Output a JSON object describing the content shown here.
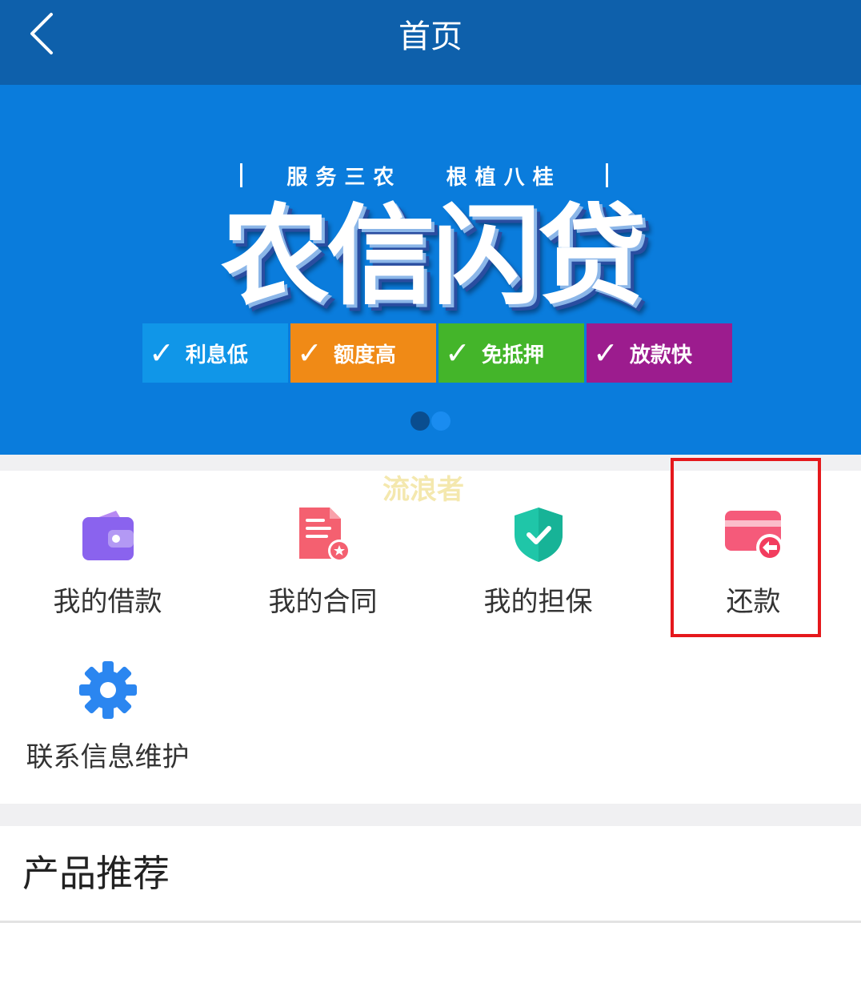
{
  "header": {
    "title": "首页",
    "back_icon": "chevron-left-icon"
  },
  "banner": {
    "slogan_left": "服务三农",
    "slogan_right": "根植八桂",
    "title": "农信闪贷",
    "tags": [
      {
        "label": "利息低",
        "color": "#1096e8"
      },
      {
        "label": "额度高",
        "color": "#f08a16"
      },
      {
        "label": "免抵押",
        "color": "#44b52a"
      },
      {
        "label": "放款快",
        "color": "#9c1c8e"
      }
    ],
    "carousel": {
      "count": 2,
      "active": 2,
      "dot_colors": [
        "#0a4d8f",
        "#1a8cf0"
      ]
    }
  },
  "menu": {
    "items": [
      {
        "label": "我的借款",
        "icon": "wallet-icon"
      },
      {
        "label": "我的合同",
        "icon": "contract-document-icon"
      },
      {
        "label": "我的担保",
        "icon": "shield-check-icon"
      },
      {
        "label": "还款",
        "icon": "card-repay-icon"
      },
      {
        "label": "联系信息维护",
        "icon": "gear-icon"
      }
    ],
    "highlighted": "还款"
  },
  "watermark": "流浪者",
  "section": {
    "title": "产品推荐"
  },
  "colors": {
    "header": "#0e60ab",
    "banner": "#0a7cdc",
    "highlight": "#e5181c"
  }
}
